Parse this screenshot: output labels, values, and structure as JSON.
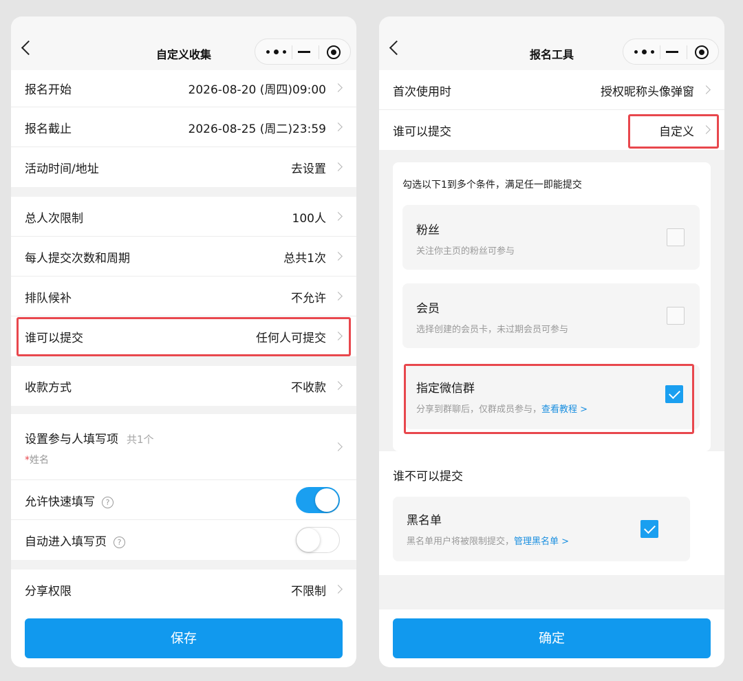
{
  "left": {
    "title": "自定义收集",
    "rows": [
      {
        "label": "报名开始",
        "value": "2026-08-20 (周四)09:00"
      },
      {
        "label": "报名截止",
        "value": "2026-08-25 (周二)23:59"
      },
      {
        "label": "活动时间/地址",
        "value": "去设置"
      },
      {
        "label": "总人次限制",
        "value": "100人"
      },
      {
        "label": "每人提交次数和周期",
        "value": "总共1次"
      },
      {
        "label": "排队候补",
        "value": "不允许"
      },
      {
        "label": "谁可以提交",
        "value": "任何人可提交"
      },
      {
        "label": "收款方式",
        "value": "不收款"
      }
    ],
    "fields": {
      "label": "设置参与人填写项",
      "count": "共1个",
      "required_mark": "*",
      "item": "姓名"
    },
    "toggles": [
      {
        "label": "允许快速填写",
        "help": "?",
        "on": true
      },
      {
        "label": "自动进入填写页",
        "help": "?",
        "on": false
      }
    ],
    "share": {
      "label": "分享权限",
      "value": "不限制"
    },
    "save_label": "保存"
  },
  "right": {
    "title": "报名工具",
    "first_use": {
      "label": "首次使用时",
      "value": "授权昵称头像弹窗"
    },
    "who_can": {
      "label": "谁可以提交",
      "value": "自定义"
    },
    "hint": "勾选以下1到多个条件，满足任一即能提交",
    "options": [
      {
        "title": "粉丝",
        "desc": "关注你主页的粉丝可参与",
        "checked": false
      },
      {
        "title": "会员",
        "desc": "选择创建的会员卡，未过期会员可参与",
        "checked": false
      },
      {
        "title": "指定微信群",
        "desc": "分享到群聊后，仅群成员参与，",
        "link": "查看教程 >",
        "checked": true
      }
    ],
    "who_cannot": "谁不可以提交",
    "blacklist": {
      "title": "黑名单",
      "desc": "黑名单用户将被限制提交，",
      "link": "管理黑名单 >",
      "checked": true
    },
    "confirm_label": "确定"
  },
  "colors": {
    "accent": "#1199ee",
    "highlight": "#e8474d",
    "link": "#1a8fe0"
  }
}
